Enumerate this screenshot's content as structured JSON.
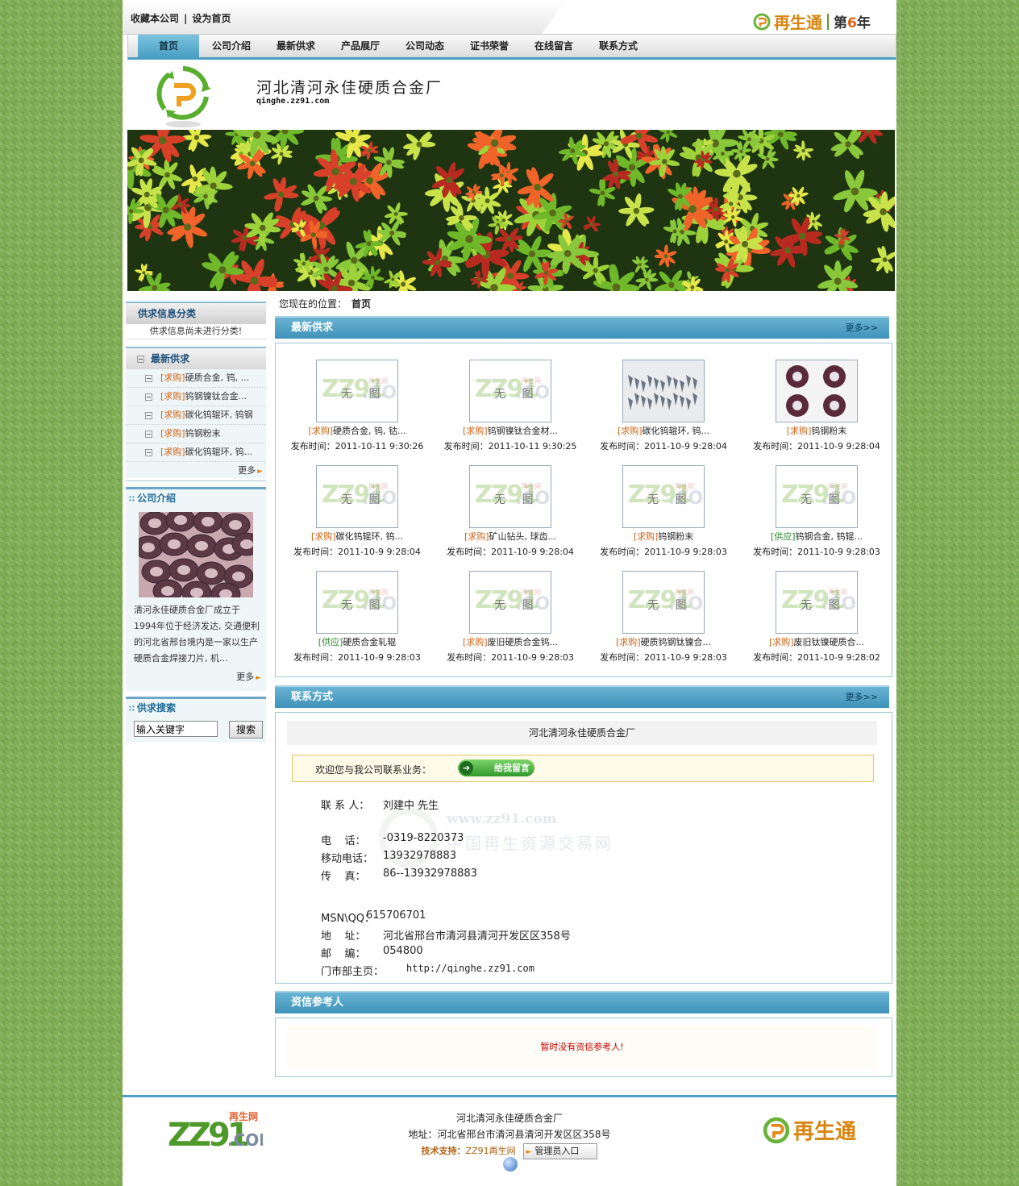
{
  "top": {
    "favorite": "收藏本公司",
    "separator": "|",
    "set_home": "设为首页",
    "brand": "再生通",
    "year_prefix": "第",
    "year_num": "6",
    "year_suffix": "年"
  },
  "nav": [
    "首页",
    "公司介绍",
    "最新供求",
    "产品展厅",
    "公司动态",
    "证书荣誉",
    "在线留言",
    "联系方式"
  ],
  "header": {
    "company": "河北清河永佳硬质合金厂",
    "url": "qinghe.zz91.com"
  },
  "sidebar": {
    "category_title": "供求信息分类",
    "category_empty": "供求信息尚未进行分类!",
    "latest_title": "最新供求",
    "latest_items": [
      {
        "tag": "[求购]",
        "text": "硬质合金, 钨, ..."
      },
      {
        "tag": "[求购]",
        "text": "钨钢镍钛合金..."
      },
      {
        "tag": "[求购]",
        "text": "碳化钨辊环, 钨钢"
      },
      {
        "tag": "[求购]",
        "text": "钨钢粉末"
      },
      {
        "tag": "[求购]",
        "text": "碳化钨辊环, 钨..."
      }
    ],
    "more": "更多",
    "intro_title": "公司介绍",
    "intro_text": "清河永佳硬质合金厂成立于1994年位于经济发达, 交通便利的河北省邢台境内是一家以生产硬质合金焊接刀片, 机...",
    "search_title": "供求搜索",
    "search_placeholder": "输入关键字",
    "search_button": "搜索"
  },
  "breadcrumb": {
    "label": "您现在的位置：",
    "current": "首页"
  },
  "latest": {
    "title": "最新供求",
    "more": "更多>>",
    "no_image": "无 图",
    "time_label": "发布时间：",
    "items": [
      {
        "tag": "[求购]",
        "supply": false,
        "title": "硬质合金, 钨, 钴...",
        "time": "2011-10-11 9:30:26",
        "image": "none"
      },
      {
        "tag": "[求购]",
        "supply": false,
        "title": "钨钢镍钛合金材...",
        "time": "2011-10-11 9:30:25",
        "image": "none"
      },
      {
        "tag": "[求购]",
        "supply": false,
        "title": "碳化钨辊环, 钨...",
        "time": "2011-10-9 9:28:04",
        "image": "pieces"
      },
      {
        "tag": "[求购]",
        "supply": false,
        "title": "钨钢粉末",
        "time": "2011-10-9 9:28:04",
        "image": "rings"
      },
      {
        "tag": "[求购]",
        "supply": false,
        "title": "碳化钨辊环, 钨...",
        "time": "2011-10-9 9:28:04",
        "image": "none"
      },
      {
        "tag": "[求购]",
        "supply": false,
        "title": "矿山钻头, 球齿...",
        "time": "2011-10-9 9:28:04",
        "image": "none"
      },
      {
        "tag": "[求购]",
        "supply": false,
        "title": "钨钢粉末",
        "time": "2011-10-9 9:28:03",
        "image": "none"
      },
      {
        "tag": "[供应]",
        "supply": true,
        "title": "钨钢合金, 钨辊...",
        "time": "2011-10-9 9:28:03",
        "image": "none"
      },
      {
        "tag": "[供应]",
        "supply": true,
        "title": "硬质合金轧辊",
        "time": "2011-10-9 9:28:03",
        "image": "none"
      },
      {
        "tag": "[求购]",
        "supply": false,
        "title": "废旧硬质合金钨...",
        "time": "2011-10-9 9:28:03",
        "image": "none"
      },
      {
        "tag": "[求购]",
        "supply": false,
        "title": "硬质钨钢钛镍合...",
        "time": "2011-10-9 9:28:03",
        "image": "none"
      },
      {
        "tag": "[求购]",
        "supply": false,
        "title": "废旧钛镍硬质合...",
        "time": "2011-10-9 9:28:02",
        "image": "none"
      }
    ]
  },
  "contact": {
    "title": "联系方式",
    "more": "更多>>",
    "company": "河北清河永佳硬质合金厂",
    "welcome": "欢迎您与我公司联系业务：",
    "message_button": "给我留言",
    "lines": [
      {
        "label": "联 系 人：",
        "value": "刘建中 先生"
      },
      {
        "label": "电    话：",
        "value": "-0319-8220373"
      },
      {
        "label": "移动电话：",
        "value": "13932978883"
      },
      {
        "label": "传    真：",
        "value": "86--13932978883"
      },
      {
        "label": "MSN\\QQ：",
        "value": "615706701"
      },
      {
        "label": "地    址：",
        "value": "河北省邢台市清河县清河开发区区358号"
      },
      {
        "label": "邮    编：",
        "value": " 054800"
      },
      {
        "label": "门市部主页：",
        "value": "http://qinghe.zz91.com"
      }
    ],
    "watermark_url": "www.zz91.com",
    "watermark_text": "中国再生资源交易网"
  },
  "reference": {
    "title": "资信参考人",
    "empty": "暂时没有资信参考人!"
  },
  "footer": {
    "company": "河北清河永佳硬质合金厂",
    "address": "地址：河北省邢台市清河县清河开发区区358号",
    "support_label": "技术支持：",
    "support_value": "ZZ91再生网",
    "admin": "管理员入口",
    "brand": "再生通",
    "zz91_small": "再生网",
    "zz91_logo": "ZZ91",
    "zz91_com": ".COM"
  },
  "colors": {
    "accent_blue": "#4a9fc4",
    "tag_buy": "#d06010",
    "tag_supply": "#2a8a2a",
    "background_green": "#7fae55"
  }
}
